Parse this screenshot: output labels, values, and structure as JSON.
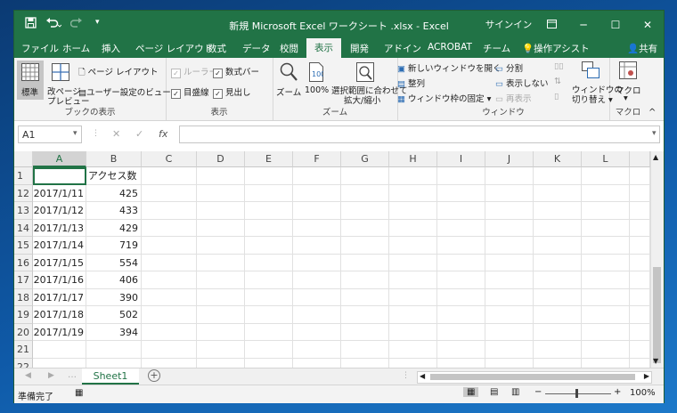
{
  "window": {
    "title": "新規 Microsoft Excel ワークシート .xlsx  -  Excel"
  },
  "qat": {
    "save": "save-icon",
    "undo": "undo-icon",
    "redo": "redo-icon",
    "customize": "customize-icon"
  },
  "titlebar": {
    "signin": "サインイン"
  },
  "tabs": [
    "ファイル",
    "ホーム",
    "挿入",
    "ページ レイアウト",
    "数式",
    "データ",
    "校閲",
    "表示",
    "開発",
    "アドイン",
    "ACROBAT",
    "チーム"
  ],
  "active_tab": "表示",
  "tell_me": "操作アシスト",
  "share": "共有",
  "ribbon": {
    "book_views": {
      "label": "ブックの表示",
      "normal": "標準",
      "page_break1": "改ページ",
      "page_break2": "プレビュー",
      "page_layout": "ページ レイアウト",
      "custom_views": "ユーザー設定のビュー"
    },
    "show": {
      "label": "表示",
      "ruler": "ルーラー",
      "formula_bar": "数式バー",
      "gridlines": "目盛線",
      "headings": "見出し"
    },
    "zoom": {
      "label": "ズーム",
      "zoom": "ズーム",
      "100": "100%",
      "zoom_sel1": "選択範囲に合わせて",
      "zoom_sel2": "拡大/縮小"
    },
    "window": {
      "label": "ウィンドウ",
      "new_window": "新しいウィンドウを開く",
      "arrange": "整列",
      "freeze": "ウィンドウ枠の固定",
      "split": "分割",
      "hide": "表示しない",
      "unhide": "再表示",
      "switch1": "ウィンドウの",
      "switch2": "切り替え"
    },
    "macro": {
      "label": "マクロ",
      "macro": "マクロ"
    }
  },
  "formula_bar": {
    "name_box": "A1",
    "fx": "fx",
    "value": ""
  },
  "columns": [
    "A",
    "B",
    "C",
    "D",
    "E",
    "F",
    "G",
    "H",
    "I",
    "J",
    "K",
    "L"
  ],
  "rows": [
    {
      "num": "1",
      "a": "",
      "b": "アクセス数"
    },
    {
      "num": "12",
      "a": "2017/1/11",
      "b": "425"
    },
    {
      "num": "13",
      "a": "2017/1/12",
      "b": "433"
    },
    {
      "num": "14",
      "a": "2017/1/13",
      "b": "429"
    },
    {
      "num": "15",
      "a": "2017/1/14",
      "b": "719"
    },
    {
      "num": "16",
      "a": "2017/1/15",
      "b": "554"
    },
    {
      "num": "17",
      "a": "2017/1/16",
      "b": "406"
    },
    {
      "num": "18",
      "a": "2017/1/17",
      "b": "390"
    },
    {
      "num": "19",
      "a": "2017/1/18",
      "b": "502"
    },
    {
      "num": "20",
      "a": "2017/1/19",
      "b": "394"
    },
    {
      "num": "21",
      "a": "",
      "b": ""
    },
    {
      "num": "22",
      "a": "",
      "b": ""
    }
  ],
  "sheet_tab": "Sheet1",
  "status": {
    "ready": "準備完了",
    "zoom": "100%"
  },
  "colors": {
    "accent": "#217346"
  }
}
